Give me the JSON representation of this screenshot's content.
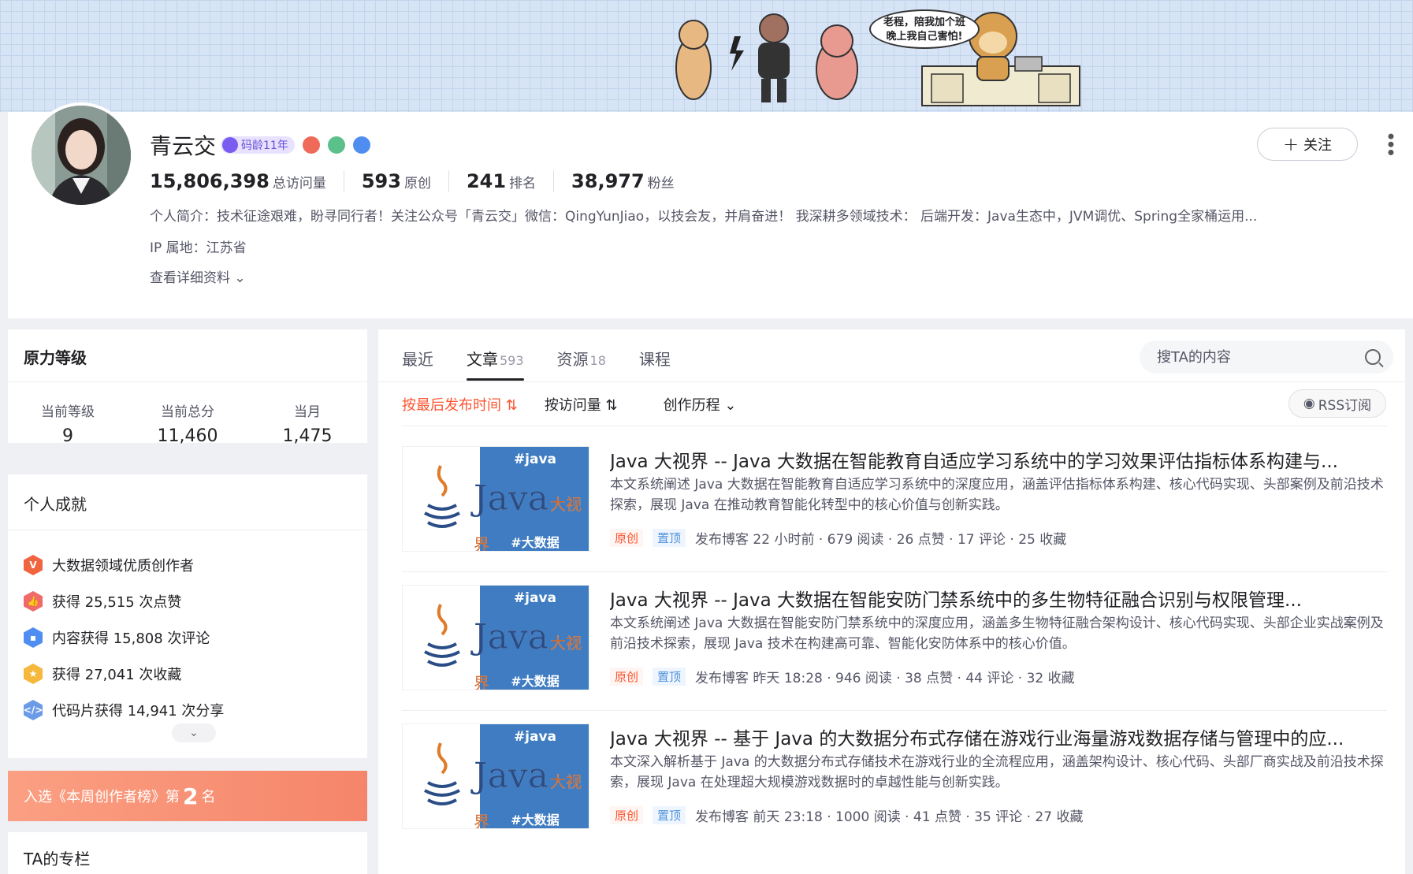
{
  "banner": {
    "bubble_line1": "老程，陪我加个班",
    "bubble_line2": "晚上我自己害怕!"
  },
  "profile": {
    "name": "青云交",
    "code_age": "码龄11年",
    "stats": [
      {
        "value": "15,806,398",
        "label": "总访问量"
      },
      {
        "value": "593",
        "label": "原创"
      },
      {
        "value": "241",
        "label": "排名"
      },
      {
        "value": "38,977",
        "label": "粉丝"
      }
    ],
    "bio": "个人简介：技术征途艰难，盼寻同行者！关注公众号「青云交」微信：QingYunJiao，以技会友，并肩奋进！ 我深耕多领域技术： 后端开发：Java生态中，JVM调优、Spring全家桶运用...",
    "ip": "IP 属地：江苏省",
    "more_info": "查看详细资料",
    "follow_label": "关注"
  },
  "level": {
    "title": "原力等级",
    "items": [
      {
        "label": "当前等级",
        "value": "9"
      },
      {
        "label": "当前总分",
        "value": "11,460"
      },
      {
        "label": "当月",
        "value": "1,475"
      }
    ]
  },
  "achievements": {
    "title": "个人成就",
    "items": [
      {
        "text": "大数据领域优质创作者",
        "icon": "v-badge-icon",
        "color": "#f0653f"
      },
      {
        "text": "获得 25,515 次点赞",
        "icon": "like-icon",
        "color": "#f06a6a"
      },
      {
        "text": "内容获得 15,808 次评论",
        "icon": "comment-icon",
        "color": "#4f8ef0"
      },
      {
        "text": "获得 27,041 次收藏",
        "icon": "star-icon",
        "color": "#f5b83c"
      },
      {
        "text": "代码片获得 14,941 次分享",
        "icon": "code-icon",
        "color": "#6b9ae8"
      }
    ]
  },
  "rank": {
    "prefix": "入选《本周创作者榜》第",
    "number": "2",
    "suffix": "名"
  },
  "column": {
    "title": "TA的专栏"
  },
  "tabs": [
    {
      "label": "最近",
      "count": ""
    },
    {
      "label": "文章",
      "count": "593"
    },
    {
      "label": "资源",
      "count": "18"
    },
    {
      "label": "课程",
      "count": ""
    }
  ],
  "search": {
    "placeholder": "搜TA的内容"
  },
  "sorts": [
    {
      "label": "按最后发布时间"
    },
    {
      "label": "按访问量"
    },
    {
      "label": "创作历程"
    }
  ],
  "rss_label": "RSS订阅",
  "thumb": {
    "tag1": "#java",
    "java": "Java",
    "sub": "大视界",
    "tag2": "#大数据"
  },
  "articles": [
    {
      "title": "Java 大视界 -- Java 大数据在智能教育自适应学习系统中的学习效果评估指标体系构建与...",
      "desc": "本文系统阐述 Java 大数据在智能教育自适应学习系统中的深度应用，涵盖评估指标体系构建、核心代码实现、头部案例及前沿技术探索，展现 Java 在推动教育智能化转型中的核心价值与创新实践。",
      "tag_orig": "原创",
      "tag_top": "置顶",
      "meta": "发布博客 22 小时前 · 679 阅读 · 26 点赞 · 17 评论 · 25 收藏"
    },
    {
      "title": "Java 大视界 -- Java 大数据在智能安防门禁系统中的多生物特征融合识别与权限管理...",
      "desc": "本文系统阐述 Java 大数据在智能安防门禁系统中的深度应用，涵盖多生物特征融合架构设计、核心代码实现、头部企业实战案例及前沿技术探索，展现 Java 技术在构建高可靠、智能化安防体系中的核心价值。",
      "tag_orig": "原创",
      "tag_top": "置顶",
      "meta": "发布博客 昨天 18:28 · 946 阅读 · 38 点赞 · 44 评论 · 32 收藏"
    },
    {
      "title": "Java 大视界 -- 基于 Java 的大数据分布式存储在游戏行业海量游戏数据存储与管理中的应...",
      "desc": "本文深入解析基于 Java 的大数据分布式存储技术在游戏行业的全流程应用，涵盖架构设计、核心代码、头部厂商实战及前沿技术探索，展现 Java 在处理超大规模游戏数据时的卓越性能与创新实践。",
      "tag_orig": "原创",
      "tag_top": "置顶",
      "meta": "发布博客 前天 23:18 · 1000 阅读 · 41 点赞 · 35 评论 · 27 收藏"
    }
  ]
}
